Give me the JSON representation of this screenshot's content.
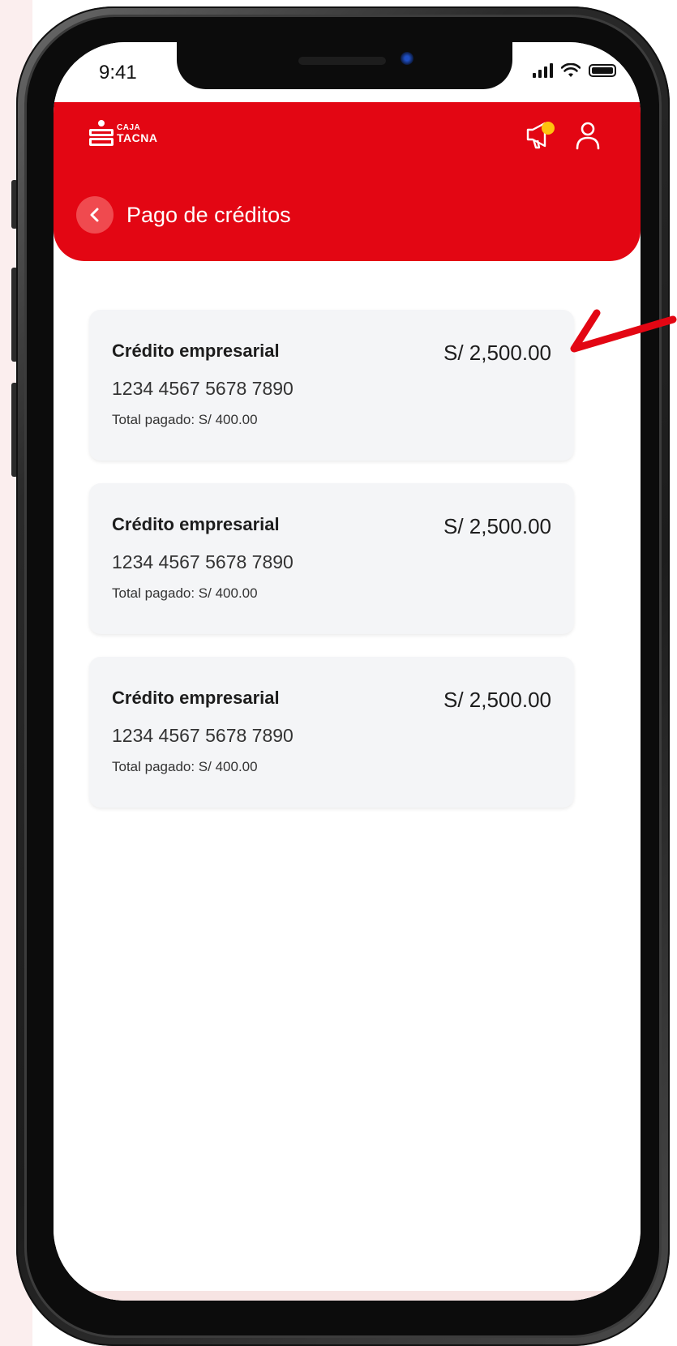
{
  "status_bar": {
    "time": "9:41"
  },
  "header": {
    "logo": {
      "line1": "CAJA",
      "line2": "TACNA"
    },
    "title": "Pago de créditos",
    "icons": [
      "back-icon",
      "megaphone-icon",
      "user-icon"
    ]
  },
  "credits": [
    {
      "title": "Crédito empresarial",
      "amount": "S/ 2,500.00",
      "number": "1234 4567 5678 7890",
      "paid": "Total pagado: S/ 400.00"
    },
    {
      "title": "Crédito empresarial",
      "amount": "S/ 2,500.00",
      "number": "1234 4567 5678 7890",
      "paid": "Total pagado: S/ 400.00"
    },
    {
      "title": "Crédito empresarial",
      "amount": "S/ 2,500.00",
      "number": "1234 4567 5678 7890",
      "paid": "Total pagado: S/ 400.00"
    }
  ],
  "colors": {
    "brand_red": "#e30613",
    "back_button": "#f04a4f",
    "card_bg": "#f4f5f7",
    "notification_dot": "#ffc20e"
  }
}
